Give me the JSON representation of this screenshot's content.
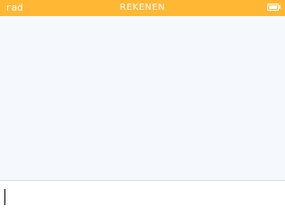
{
  "status_bar": {
    "angle_mode": "rad",
    "title": "REKENEN",
    "battery": {
      "icon": "battery-icon",
      "level": 1.0
    }
  },
  "colors": {
    "status_bar": "#ffb734",
    "status_text": "#ffffff",
    "history_background": "#f5f9fe",
    "input_background": "#ffffff",
    "divider": "#d9dde3",
    "cursor": "#000000"
  },
  "input": {
    "value": ""
  }
}
